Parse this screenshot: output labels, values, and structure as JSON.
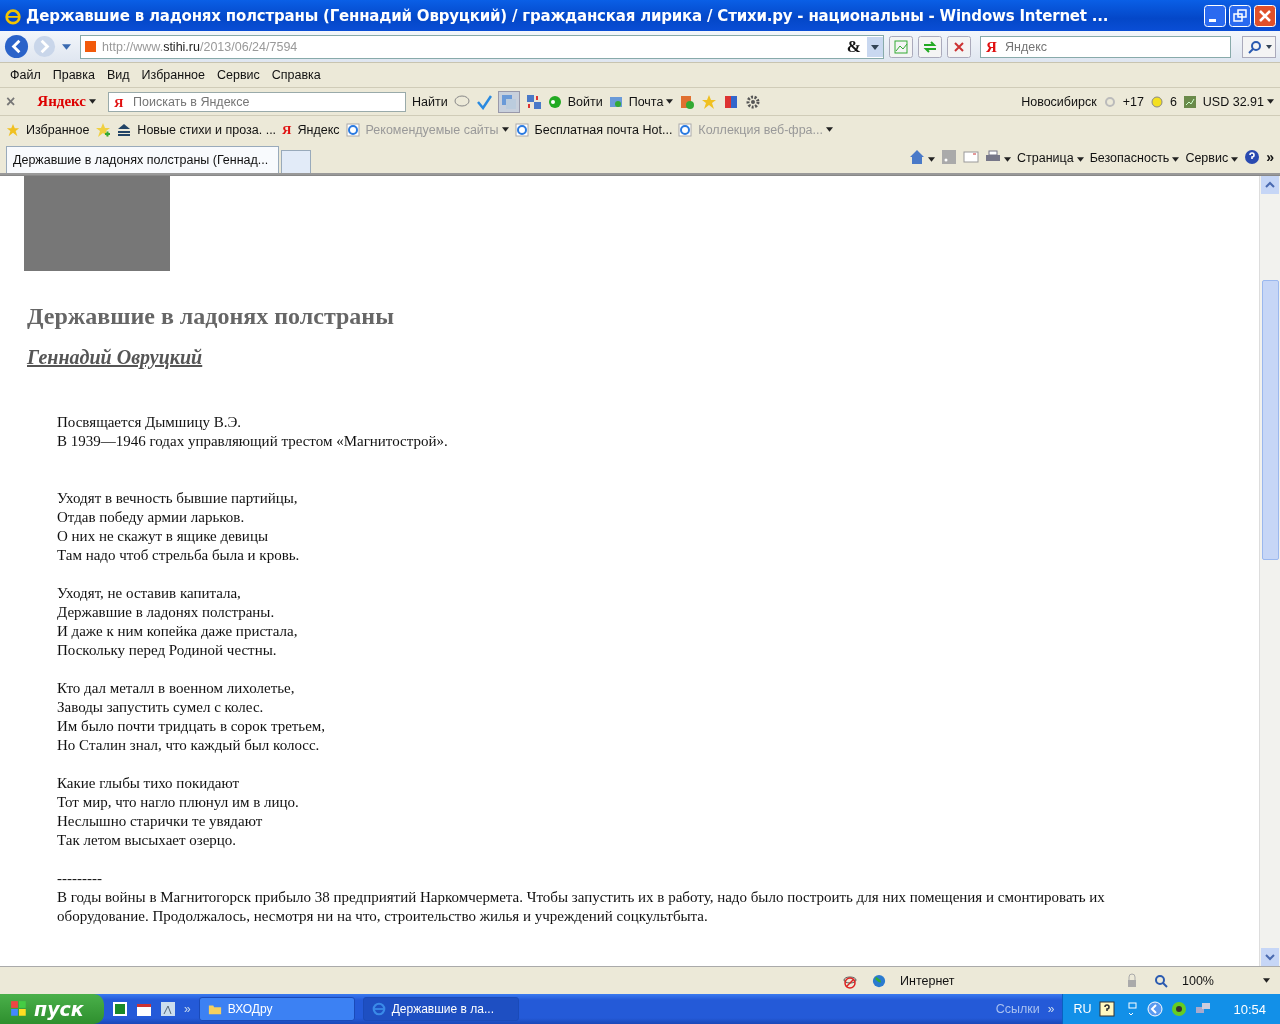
{
  "window": {
    "title": "Державшие в ладонях полстраны (Геннадий Овруцкий) / гражданская лирика / Стихи.ру - национальны - Windows Internet ..."
  },
  "address": {
    "url_prefix": "http://www.",
    "url_domain": "stihi.ru",
    "url_path": "/2013/06/24/7594",
    "compat": "&"
  },
  "search": {
    "icon": "Я",
    "placeholder": "Яндекс"
  },
  "menu": [
    "Файл",
    "Правка",
    "Вид",
    "Избранное",
    "Сервис",
    "Справка"
  ],
  "yandex_bar": {
    "close": "×",
    "logo": "Яндекс",
    "icon": "Я",
    "placeholder": "Поискать в Яндексе",
    "find": "Найти",
    "login": "Войти",
    "mail": "Почта",
    "city": "Новосибирск",
    "temperature": "+17",
    "traffic": "6",
    "currency": "USD 32.91"
  },
  "favorites": {
    "label": "Избранное",
    "links": [
      {
        "label": "Новые стихи и проза. ...",
        "dimmed": false,
        "kind": "stack"
      },
      {
        "label": "Яндекс",
        "dimmed": false,
        "kind": "yandex",
        "icon": "Я"
      },
      {
        "label": "Рекомендуемые сайты",
        "dimmed": true,
        "kind": "ie"
      },
      {
        "label": "Бесплатная почта Hot...",
        "dimmed": false,
        "kind": "ie"
      },
      {
        "label": "Коллекция веб-фра...",
        "dimmed": true,
        "kind": "ie"
      }
    ]
  },
  "tabs": [
    {
      "label": "Державшие в ладонях полстраны (Геннад...",
      "selected": true
    }
  ],
  "command_bar": [
    "Страница",
    "Безопасность",
    "Сервис"
  ],
  "more": "»",
  "page": {
    "heading": "Державшие в ладонях полстраны",
    "author": "Геннадий Овруцкий",
    "dedication": [
      "Посвящается Дымшицу В.Э.",
      "В 1939—1946 годах управляющий трестом «Магнитострой»."
    ],
    "stanzas": [
      [
        "Уходят в вечность бывшие партийцы,",
        "Отдав победу армии ларьков.",
        "О них не скажут в ящике девицы",
        "Там надо чтоб стрельба была и кровь."
      ],
      [
        "Уходят, не оставив капитала,",
        "Державшие в ладонях полстраны.",
        "И даже к ним копейка даже пристала,",
        "Поскольку перед Родиной честны."
      ],
      [
        "Кто дал металл в военном лихолетье,",
        "Заводы запустить сумел с колес.",
        "Им было почти тридцать в сорок третьем,",
        "Но Сталин знал, что каждый был колосс."
      ],
      [
        "Какие глыбы тихо покидают",
        "Тот мир, что нагло плюнул им в лицо.",
        "Неслышно старички те увядают",
        "Так летом высыхает озерцо."
      ]
    ],
    "separator": "---------",
    "note": "В годы войны в Магнитогорск прибыло 38 предприятий Наркомчермета. Чтобы запустить их в работу, надо было построить для них помещения и смонтировать их оборудование. Продолжалось, несмотря ни на что, строительство жилья и учреждений соцкультбыта."
  },
  "status_bar": {
    "zone": "Интернет",
    "zoom": "100%"
  },
  "taskbar": {
    "start": "пуск",
    "more": "»",
    "tasks": [
      {
        "label": "ВХОДру",
        "selected": false,
        "kind": "folder"
      },
      {
        "label": "Державшие в ла...",
        "selected": true,
        "kind": "ie"
      }
    ],
    "links": "Ссылки",
    "links_more": "»",
    "language": "RU",
    "clock": "10:54"
  }
}
